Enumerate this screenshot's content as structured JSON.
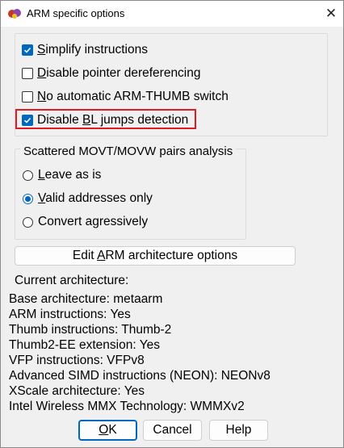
{
  "window": {
    "title": "ARM specific options",
    "close_glyph": "✕"
  },
  "options": {
    "simplify": {
      "pre": "",
      "u": "S",
      "post": "implify instructions",
      "checked": true
    },
    "disable_deref": {
      "pre": "",
      "u": "D",
      "post": "isable pointer dereferencing",
      "checked": false
    },
    "no_auto_switch": {
      "pre": "",
      "u": "N",
      "post": "o automatic ARM-THUMB switch",
      "checked": false
    },
    "disable_bl": {
      "pre": "Disable ",
      "u": "B",
      "post": "L jumps detection",
      "checked": true
    }
  },
  "movt_group": {
    "title": "Scattered MOVT/MOVW pairs analysis",
    "leave": {
      "pre": "",
      "u": "L",
      "post": "eave as is",
      "selected": false
    },
    "valid": {
      "pre": "",
      "u": "V",
      "post": "alid addresses only",
      "selected": true
    },
    "convert": {
      "text": "Convert agressively",
      "selected": false
    }
  },
  "edit_button": {
    "pre": "Edit ",
    "u": "A",
    "post": "RM architecture options"
  },
  "current_architecture_label": "Current architecture:",
  "arch_info": [
    "Base architecture: metaarm",
    "ARM instructions: Yes",
    "Thumb instructions: Thumb-2",
    "Thumb2-EE extension: Yes",
    "VFP instructions: VFPv8",
    "Advanced SIMD instructions (NEON): NEONv8",
    "XScale architecture: Yes",
    "Intel Wireless MMX Technology: WMMXv2"
  ],
  "buttons": {
    "ok": {
      "u": "O",
      "post": "K"
    },
    "cancel": "Cancel",
    "help": "Help"
  },
  "colors": {
    "accent": "#0067c0",
    "highlight": "#e01b24"
  }
}
